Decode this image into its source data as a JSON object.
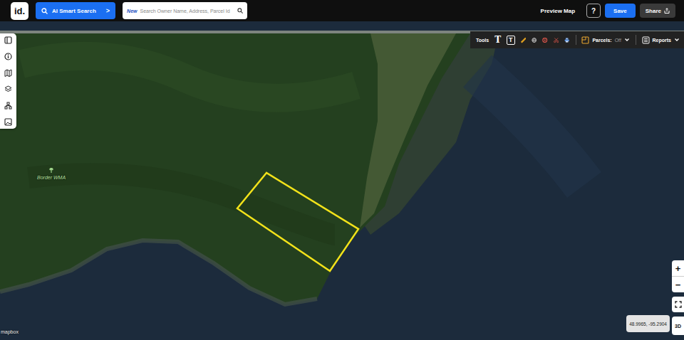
{
  "logo": "id.",
  "ai_search": {
    "label": "AI Smart Search",
    "chevron": ">"
  },
  "search": {
    "badge": "New",
    "placeholder": "Search Owner Name, Address, Parcel Id"
  },
  "header_actions": {
    "preview": "Preview Map",
    "help": "?",
    "save": "Save",
    "share": "Share"
  },
  "tools": {
    "label": "Tools",
    "text_tool": "T",
    "text_box_tool": "T",
    "parcels": {
      "label": "Parcels:",
      "state": "Off"
    },
    "reports": "Reports"
  },
  "map": {
    "poi": "Border WMA",
    "attribution": "mapbox",
    "coordinates": "48.9965, -95.2904"
  },
  "zoom": {
    "in": "+",
    "out": "−",
    "view3d": "3D"
  }
}
